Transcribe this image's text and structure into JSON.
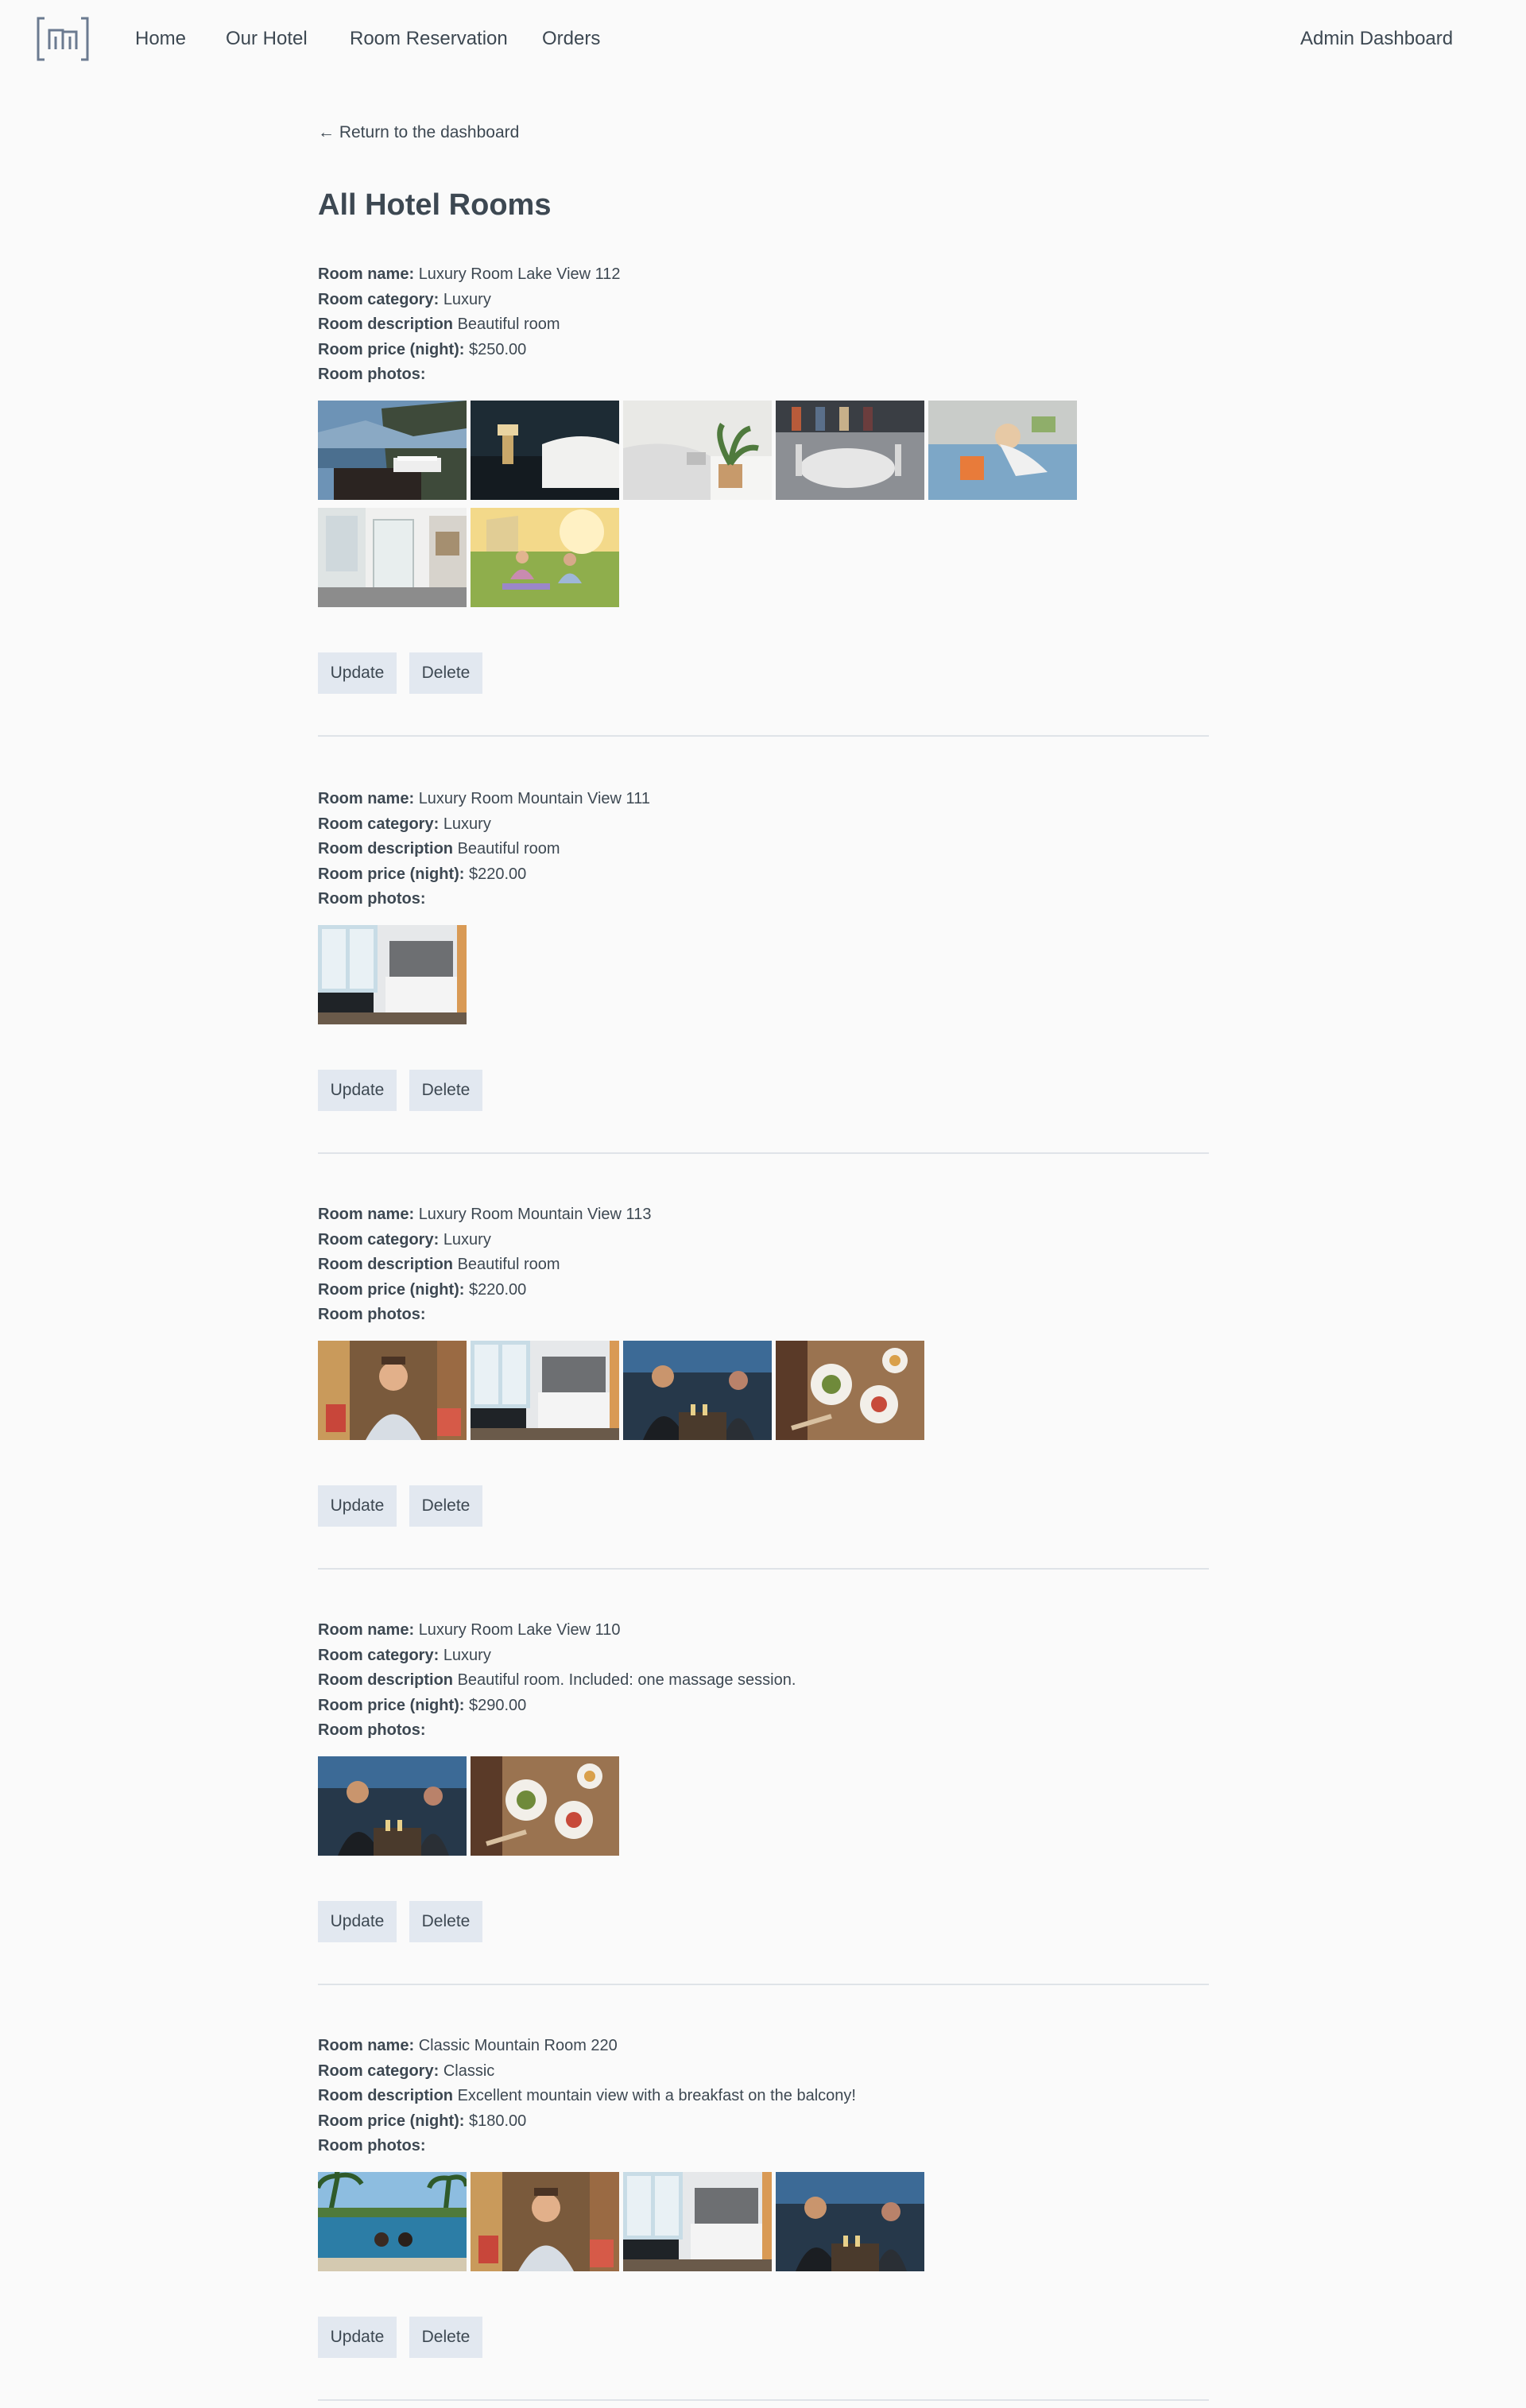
{
  "nav": {
    "logo": "m-logo-icon",
    "links": [
      "Home",
      "Our Hotel",
      "Room Reservation",
      "Orders"
    ],
    "admin": "Admin Dashboard"
  },
  "back_link": "← Return to the dashboard",
  "page_title": "All Hotel Rooms",
  "labels": {
    "name": "Room name:",
    "category": "Room category:",
    "description": "Room description",
    "price": "Room price (night):",
    "photos": "Room photos:"
  },
  "buttons": {
    "update": "Update",
    "delete": "Delete"
  },
  "rooms": [
    {
      "name": "Luxury Room Lake View 112",
      "category": "Luxury",
      "description": "Beautiful room",
      "price": "$250.00",
      "photos": [
        "lake-terrace",
        "dark-bedroom",
        "bed-plant",
        "restaurant-table",
        "kids-bed",
        "bathroom-shower",
        "yoga-lawn"
      ]
    },
    {
      "name": "Luxury Room Mountain View 111",
      "category": "Luxury",
      "description": "Beautiful room",
      "price": "$220.00",
      "photos": [
        "hotel-room"
      ]
    },
    {
      "name": "Luxury Room Mountain View 113",
      "category": "Luxury",
      "description": "Beautiful room",
      "price": "$220.00",
      "photos": [
        "chef-portrait",
        "hotel-room",
        "bartender",
        "food-plates"
      ]
    },
    {
      "name": "Luxury Room Lake View 110",
      "category": "Luxury",
      "description": "Beautiful room. Included: one massage session.",
      "price": "$290.00",
      "photos": [
        "bartender",
        "food-plates"
      ]
    },
    {
      "name": "Classic Mountain Room 220",
      "category": "Classic",
      "description": "Excellent mountain view with a breakfast on the balcony!",
      "price": "$180.00",
      "photos": [
        "pool-palms",
        "chef-portrait",
        "hotel-room",
        "bartender"
      ]
    }
  ]
}
